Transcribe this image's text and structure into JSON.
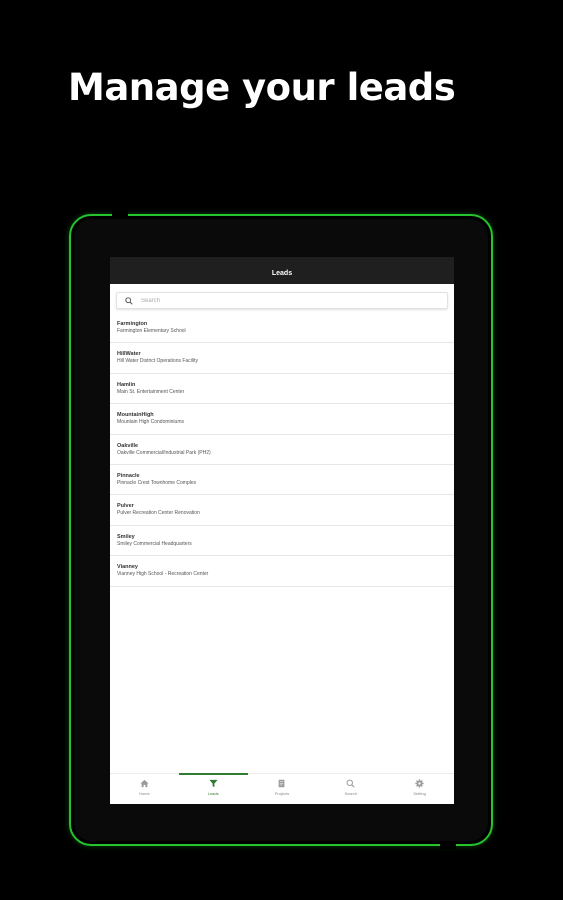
{
  "hero": {
    "title": "Manage your leads"
  },
  "app_bar": {
    "title": "Leads"
  },
  "search": {
    "placeholder": "Search"
  },
  "leads": [
    {
      "name": "Farmington",
      "desc": "Farmington Elementary School"
    },
    {
      "name": "HillWater",
      "desc": "Hill Water District Operations Facility"
    },
    {
      "name": "Hamlin",
      "desc": "Main St. Entertainment Center"
    },
    {
      "name": "MountainHigh",
      "desc": "Mountain High Condominiums"
    },
    {
      "name": "Oakville",
      "desc": "Oakville Commercial/Industrial Park (PH2)"
    },
    {
      "name": "Pinnacle",
      "desc": "Pinnacle Crest Townhome Complex"
    },
    {
      "name": "Pulver",
      "desc": "Pulver Recreation Center Renovation"
    },
    {
      "name": "Smiley",
      "desc": "Smiley Commercial Headquarters"
    },
    {
      "name": "Vianney",
      "desc": "Vianney High School - Recreation Center"
    }
  ],
  "nav": {
    "items": [
      {
        "label": "Home",
        "icon": "home-icon",
        "active": false
      },
      {
        "label": "Leads",
        "icon": "funnel-icon",
        "active": true
      },
      {
        "label": "Projects",
        "icon": "document-icon",
        "active": false
      },
      {
        "label": "Search",
        "icon": "search-icon",
        "active": false
      },
      {
        "label": "Setting",
        "icon": "gear-icon",
        "active": false
      }
    ]
  },
  "colors": {
    "background": "#000000",
    "frame_accent": "#25c42f",
    "app_bar": "#1f1f1f",
    "active_nav": "#2e7d32"
  }
}
